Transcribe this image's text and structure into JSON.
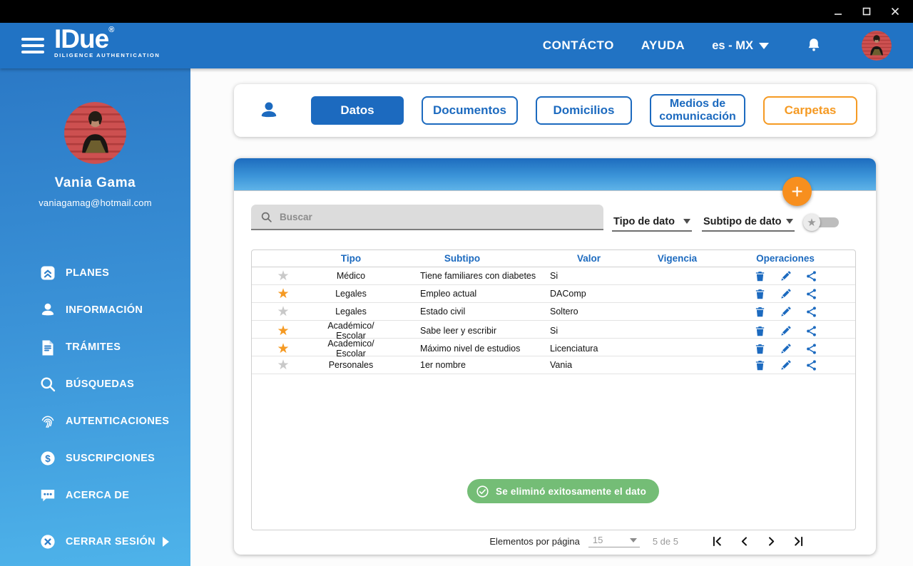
{
  "window": {
    "controls": [
      "minimize",
      "maximize",
      "close"
    ]
  },
  "header": {
    "logo": {
      "title": "IDue",
      "registered": "®",
      "tagline": "DILIGENCE AUTHENTICATION"
    },
    "nav": {
      "contact": "CONTÁCTO",
      "help": "AYUDA"
    },
    "language": {
      "selected": "es - MX"
    },
    "notifications_icon": "bell-icon"
  },
  "sidebar": {
    "profile": {
      "name": "Vania Gama",
      "email": "vaniagamag@hotmail.com"
    },
    "items": [
      {
        "label": "PLANES",
        "icon": "plans-icon"
      },
      {
        "label": "INFORMACIÓN",
        "icon": "person-icon"
      },
      {
        "label": "TRÁMITES",
        "icon": "document-icon"
      },
      {
        "label": "BÚSQUEDAS",
        "icon": "search-icon"
      },
      {
        "label": "AUTENTICACIONES",
        "icon": "fingerprint-icon"
      },
      {
        "label": "SUSCRIPCIONES",
        "icon": "dollar-icon"
      },
      {
        "label": "ACERCA DE",
        "icon": "chat-icon"
      }
    ],
    "logout": {
      "label": "CERRAR SESIÓN",
      "icon": "close-circle-icon"
    }
  },
  "tabs": [
    {
      "label": "Datos",
      "style": "primary",
      "active": true
    },
    {
      "label": "Documentos",
      "style": "outline-blue",
      "active": false
    },
    {
      "label": "Domicilios",
      "style": "outline-blue",
      "active": false
    },
    {
      "label": "Medios de comunicación",
      "style": "outline-blue wrap2",
      "active": false
    },
    {
      "label": "Carpetas",
      "style": "outline-orange",
      "active": false
    }
  ],
  "panel": {
    "search_placeholder": "Buscar",
    "filters": {
      "tipo": "Tipo de dato",
      "subtipo": "Subtipo de dato"
    },
    "favorites_toggle": {
      "icon": "star-icon",
      "state": "off"
    },
    "add_button_label": "+"
  },
  "table": {
    "headers": [
      "Tipo",
      "Subtipo",
      "Valor",
      "Vigencia",
      "Operaciones"
    ],
    "rows": [
      {
        "starred": false,
        "tipo": "Médico",
        "subtipo": "Tiene familiares con diabetes",
        "valor": "Si",
        "vigencia": ""
      },
      {
        "starred": true,
        "tipo": "Legales",
        "subtipo": "Empleo actual",
        "valor": "DAComp",
        "vigencia": ""
      },
      {
        "starred": false,
        "tipo": "Legales",
        "subtipo": "Estado civil",
        "valor": "Soltero",
        "vigencia": ""
      },
      {
        "starred": true,
        "tipo": "Académico/ Escolar",
        "subtipo": "Sabe leer y escribir",
        "valor": "Si",
        "vigencia": ""
      },
      {
        "starred": true,
        "tipo": "Academico/ Escolar",
        "subtipo": "Máximo nivel de estudios",
        "valor": "Licenciatura",
        "vigencia": ""
      },
      {
        "starred": false,
        "tipo": "Personales",
        "subtipo": "1er nombre",
        "valor": "Vania",
        "vigencia": ""
      }
    ],
    "operations": [
      "delete",
      "edit",
      "share"
    ]
  },
  "toast": {
    "message": "Se eliminó exitosamente el dato",
    "icon": "check-circle-icon"
  },
  "pagination": {
    "label": "Elementos por página",
    "page_size": "15",
    "range": "5 de 5"
  },
  "colors": {
    "accent_blue": "#1c6abf",
    "header_blue": "#2173c4",
    "orange": "#f59a23",
    "toast_green": "#74bd76"
  }
}
